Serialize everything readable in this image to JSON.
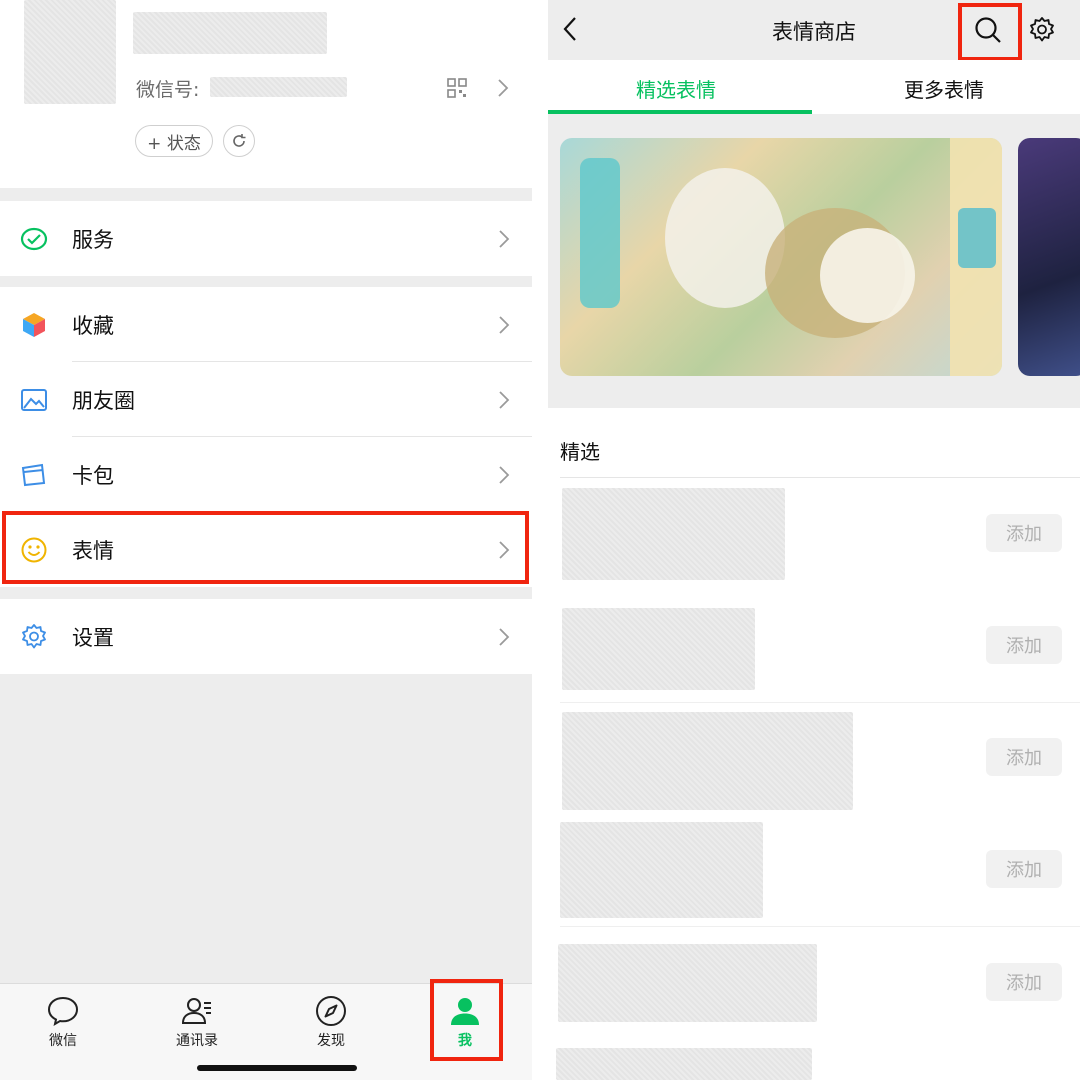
{
  "left": {
    "profile": {
      "wechat_id_label": "微信号:",
      "status_label": "+ 状态"
    },
    "menu": {
      "services": "服务",
      "favorites": "收藏",
      "moments": "朋友圈",
      "cards": "卡包",
      "stickers": "表情",
      "settings": "设置"
    },
    "tabbar": {
      "chats": "微信",
      "contacts": "通讯录",
      "discover": "发现",
      "me": "我"
    },
    "colors": {
      "accent": "#07c160",
      "highlight": "#f0250f"
    }
  },
  "right": {
    "header": {
      "title": "表情商店"
    },
    "tabs": {
      "featured": "精选表情",
      "more": "更多表情"
    },
    "section": {
      "title": "精选"
    },
    "items": [
      {
        "add_label": "添加"
      },
      {
        "add_label": "添加"
      },
      {
        "add_label": "添加"
      },
      {
        "add_label": "添加"
      },
      {
        "add_label": "添加"
      }
    ]
  }
}
